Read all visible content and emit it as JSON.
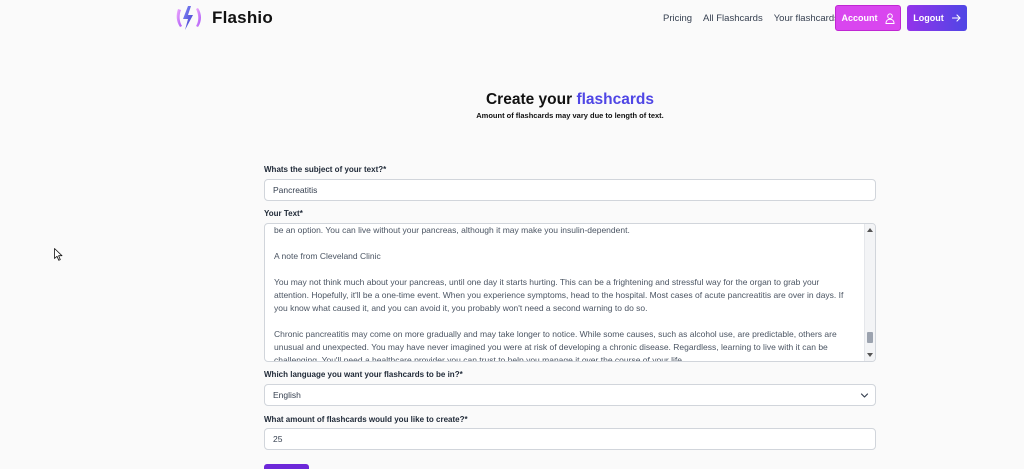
{
  "brand": {
    "name": "Flashio"
  },
  "nav": {
    "links": [
      "Pricing",
      "All Flashcards",
      "Your flashcards"
    ],
    "account_label": "Account",
    "logout_label": "Logout"
  },
  "hero": {
    "title_prefix": "Create your",
    "title_accent": "flashcards",
    "subtitle": "Amount of flashcards may vary due to length of text."
  },
  "form": {
    "subject_label": "Whats the subject of your text?*",
    "subject_value": "Pancreatitis",
    "text_label": "Your Text*",
    "text_lines": {
      "l1": "be an option. You can live without your pancreas, although it may make you insulin-dependent.",
      "l2": "A note from Cleveland Clinic",
      "l3a": "You may not think much about your pancreas, until one day it starts hurting. This can be a frightening and stressful way for the organ to grab your",
      "l3b": "attention. Hopefully, it'll be a one-time event. When you experience symptoms, head to the hospital. Most cases of acute pancreatitis are over in days. If",
      "l3c": "you know what caused it, and you can avoid it, you probably won't need a second warning to do so.",
      "l4a": "Chronic pancreatitis may come on more gradually and may take longer to notice. While some causes, such as alcohol use, are predictable, others are",
      "l4b": "unusual and unexpected. You may have never imagined you were at risk of developing a chronic disease. Regardless, learning to live with it can be",
      "l4c": "challenging. You'll need a healthcare provider you can trust to help you manage it over the course of your life."
    },
    "language_label": "Which language you want your flashcards to be in?*",
    "language_value": "English",
    "amount_label": "What amount of flashcards would you like to create?*",
    "amount_value": "25"
  },
  "colors": {
    "accent": "#4f46e5",
    "account_button": "#d946ef",
    "logout_gradient_start": "#9333ea",
    "logout_gradient_end": "#4f46e5",
    "spellcheck_underline": "#e11d48"
  },
  "icons": {
    "logo": "lightning-bolt-logo-icon",
    "account": "user-icon",
    "logout": "arrow-right-icon",
    "select": "chevron-down-icon",
    "cursor": "mouse-pointer-icon"
  }
}
